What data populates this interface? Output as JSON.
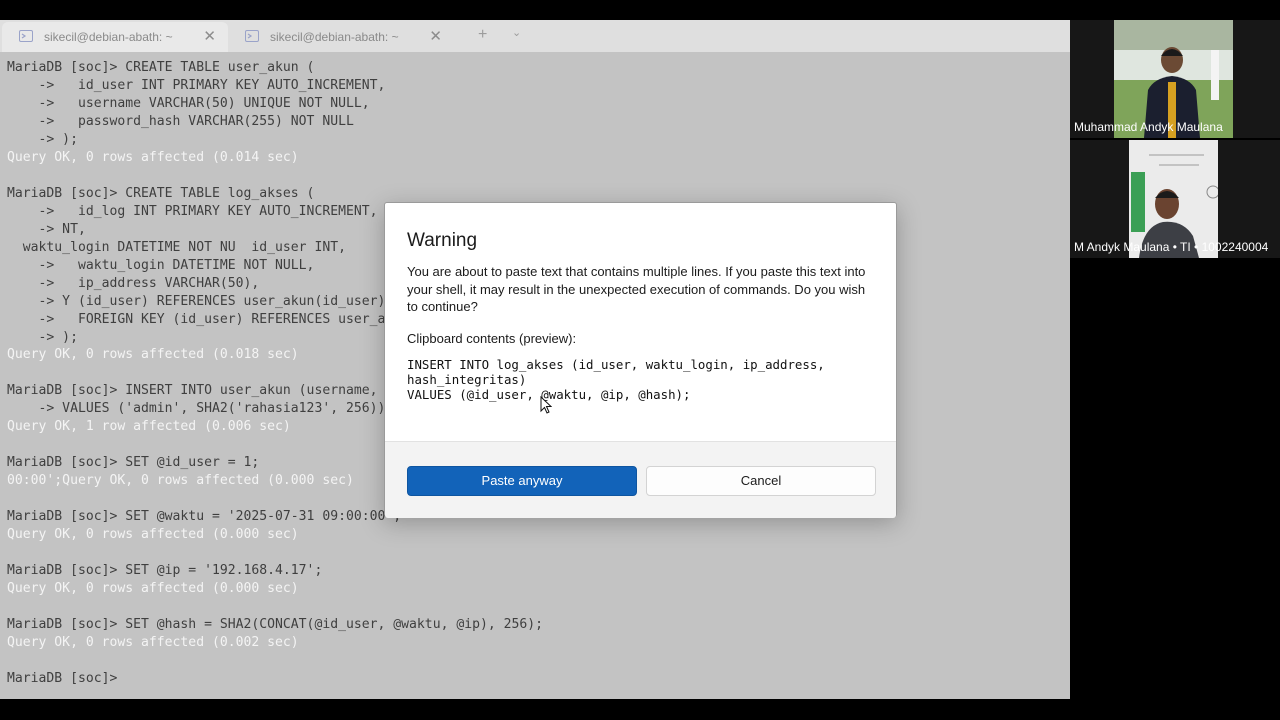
{
  "tabs": [
    {
      "label": "sikecil@debian-abath: ~",
      "close": "✕",
      "active": true
    },
    {
      "label": "sikecil@debian-abath: ~",
      "close": "✕",
      "active": false
    }
  ],
  "tabbar": {
    "new_tab": "+",
    "dropdown": "⌄"
  },
  "terminal": {
    "lines": [
      "MariaDB [soc]> CREATE TABLE user_akun (",
      "    ->   id_user INT PRIMARY KEY AUTO_INCREMENT,",
      "    ->   username VARCHAR(50) UNIQUE NOT NULL,",
      "    ->   password_hash VARCHAR(255) NOT NULL",
      "    -> );",
      "Query OK, 0 rows affected (0.014 sec)",
      "",
      "MariaDB [soc]> CREATE TABLE log_akses (",
      "    ->   id_log INT PRIMARY KEY AUTO_INCREMENT,",
      "    -> NT,",
      "  waktu_login DATETIME NOT NU  id_user INT,",
      "    ->   waktu_login DATETIME NOT NULL,",
      "    ->   ip_address VARCHAR(50),",
      "    -> Y (id_user) REFERENCES user_akun(id_user)",
      "    ->   FOREIGN KEY (id_user) REFERENCES user_akun(id_user)",
      "    -> );",
      "Query OK, 0 rows affected (0.018 sec)",
      "",
      "MariaDB [soc]> INSERT INTO user_akun (username, password_hash)",
      "    -> VALUES ('admin', SHA2('rahasia123', 256));",
      "Query OK, 1 row affected (0.006 sec)",
      "",
      "MariaDB [soc]> SET @id_user = 1;",
      "00:00';Query OK, 0 rows affected (0.000 sec)",
      "",
      "MariaDB [soc]> SET @waktu = '2025-07-31 09:00:00';",
      "Query OK, 0 rows affected (0.000 sec)",
      "",
      "MariaDB [soc]> SET @ip = '192.168.4.17';",
      "Query OK, 0 rows affected (0.000 sec)",
      "",
      "MariaDB [soc]> SET @hash = SHA2(CONCAT(@id_user, @waktu, @ip), 256);",
      "Query OK, 0 rows affected (0.002 sec)",
      "",
      "MariaDB [soc]> "
    ]
  },
  "participants": [
    {
      "name": "Muhammad Andyk Maulana"
    },
    {
      "name": "M Andyk Maulana • TI • 1002240004"
    }
  ],
  "dialog": {
    "title": "Warning",
    "message": "You are about to paste text that contains multiple lines. If you paste this text into your shell, it may result in the unexpected execution of commands. Do you wish to continue?",
    "clipboard_label": "Clipboard contents (preview):",
    "clipboard_preview": "INSERT INTO log_akses (id_user, waktu_login, ip_address,\nhash_integritas)\nVALUES (@id_user, @waktu, @ip, @hash);",
    "paste_label": "Paste anyway",
    "cancel_label": "Cancel"
  },
  "colors": {
    "primary_button": "#1263b9",
    "terminal_bg": "#c3c3c3",
    "terminal_text": "#3f3f3f"
  }
}
